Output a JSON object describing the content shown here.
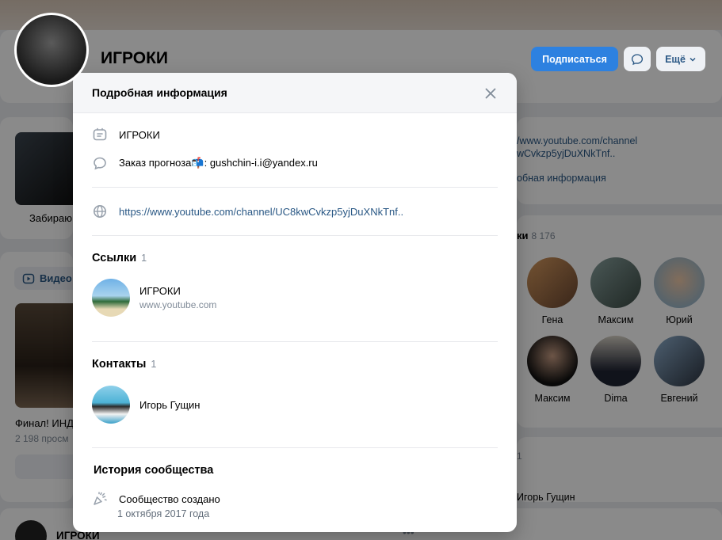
{
  "background": {
    "group_name": "ИГРОКИ",
    "subscribe_label": "Подписаться",
    "more_label": "Ещё",
    "photo_caption": "Забираю",
    "video_tab_label": "Видео",
    "video_title": "Финал! ИНД",
    "video_views": "2 198 просм",
    "post_author": "ИГРОКИ",
    "post_menu": "•••",
    "right_link_line1": "/www.youtube.com/channel",
    "right_link_line2": "wCvkzp5yjDuXNkTnf..",
    "right_more_info": "обная информация",
    "members_title": "ки",
    "members_count": "8 176",
    "members": [
      {
        "name": "Гена"
      },
      {
        "name": "Максим"
      },
      {
        "name": "Юрий"
      },
      {
        "name": "Максим"
      },
      {
        "name": "Dima"
      },
      {
        "name": "Евгений"
      }
    ],
    "contacts_count": "1",
    "contact_name": "Игорь Гущин"
  },
  "modal": {
    "title": "Подробная информация",
    "info": {
      "name": "ИГРОКИ",
      "description": "Заказ прогноза📬: gushchin-i.i@yandex.ru",
      "website": "https://www.youtube.com/channel/UC8kwCvkzp5yjDuXNkTnf.."
    },
    "links": {
      "title": "Ссылки",
      "count": "1",
      "items": [
        {
          "name": "ИГРОКИ",
          "url": "www.youtube.com"
        }
      ]
    },
    "contacts": {
      "title": "Контакты",
      "count": "1",
      "items": [
        {
          "name": "Игорь Гущин"
        }
      ]
    },
    "history": {
      "title": "История сообщества",
      "created_label": "Сообщество создано",
      "created_date": "1 октября 2017 года"
    }
  },
  "colors": {
    "accent": "#2d81e0",
    "link": "#2a5885",
    "secondary_text": "#818c99",
    "separator": "#e7e8ec"
  }
}
